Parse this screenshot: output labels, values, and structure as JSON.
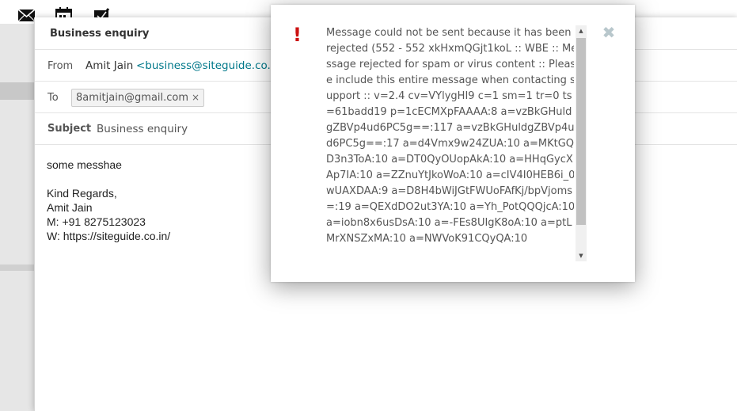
{
  "toolbar": {
    "icons": [
      "mail-icon",
      "calendar-icon",
      "tasks-icon"
    ]
  },
  "compose": {
    "title": "Business enquiry",
    "from_label": "From",
    "from_name": "Amit Jain",
    "from_address": "<business@siteguide.co.in>",
    "to_label": "To",
    "to_recipient": "8amitjain@gmail.com",
    "to_remove": "×",
    "subject_label": "Subject",
    "subject_value": "Business enquiry",
    "body_lines": [
      "some messhae",
      "",
      "Kind Regards,",
      "Amit Jain",
      "M: +91 8275123023",
      "W: https://siteguide.co.in/"
    ]
  },
  "dialog": {
    "icon": "!",
    "close_glyph": "✖",
    "message": "Message could not be sent because it has been rejected (552 - 552 xkHxmQGjt1koL :: WBE :: Message rejected for spam or virus content :: Please include this entire message when contacting support :: v=2.4 cv=VYlygHI9 c=1 sm=1 tr=0 ts=61badd19 p=1cECMXpFAAAA:8 a=vzBkGHuldgZBVp4ud6PC5g==:117 a=vzBkGHuldgZBVp4ud6PC5g==:17 a=d4Vmx9w24ZUA:10 a=MKtGQD3n3ToA:10 a=DT0QyOUopAkA:10 a=HHqGycXAp7IA:10 a=ZZnuYtJkoWoA:10 a=cIV4I0HEB6i_0wUAXDAA:9 a=D8H4bWiJGtFWUoFAfKj/bpVjoms=:19 a=QEXdDO2ut3YA:10 a=Yh_PotQQQjcA:10 a=iobn8x6usDsA:10 a=-FEs8UIgK8oA:10 a=ptLMrXNSZxMA:10 a=NWVoK91CQyQA:10"
  }
}
